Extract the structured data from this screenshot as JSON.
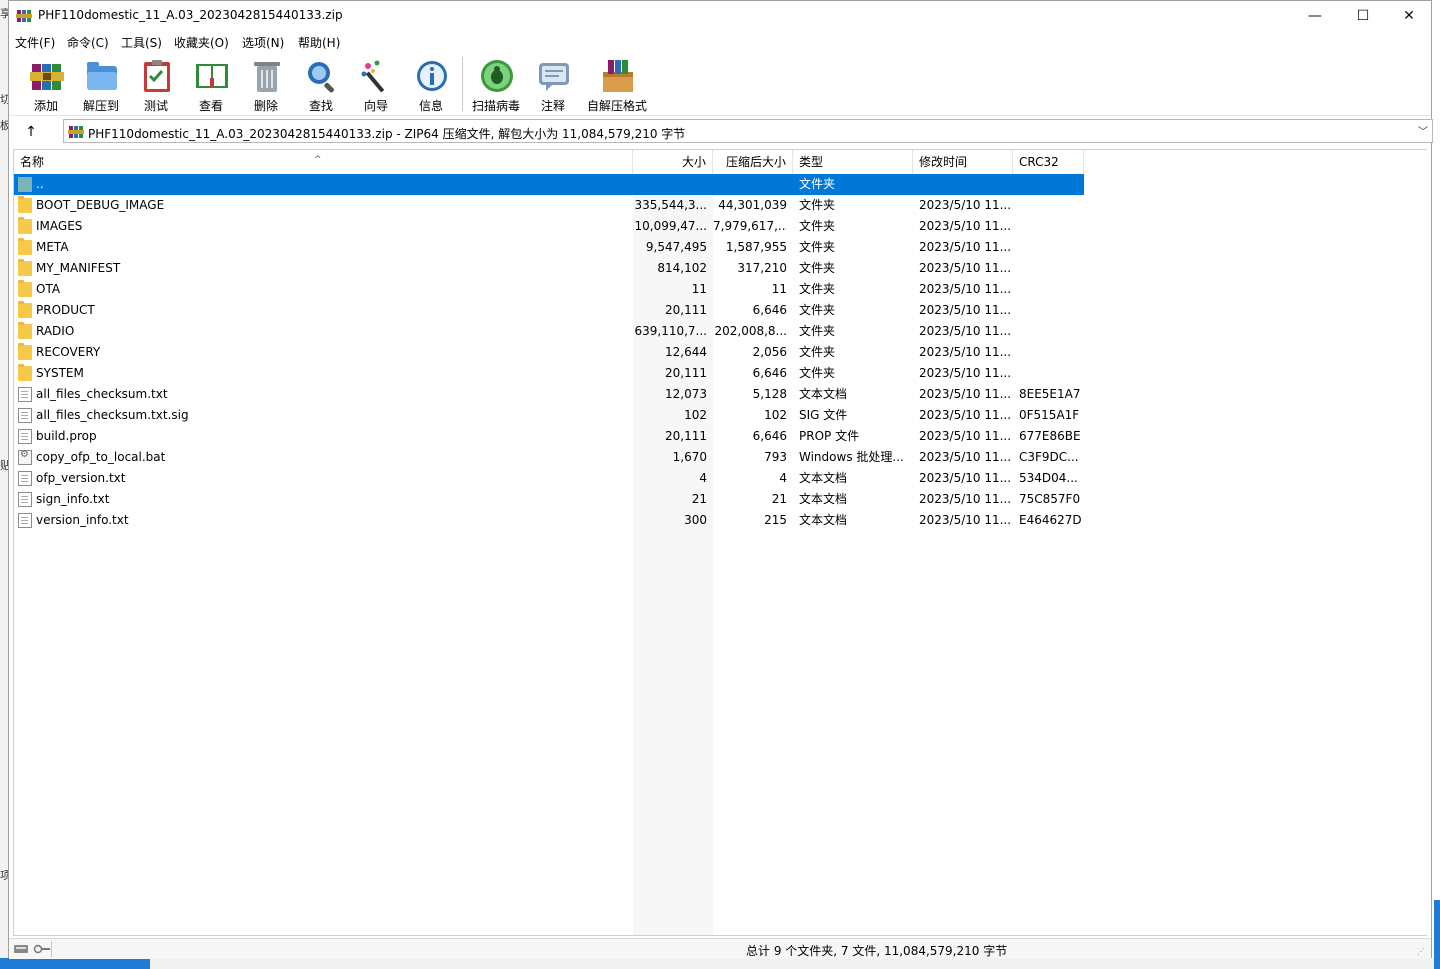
{
  "window": {
    "title": "PHF110domestic_11_A.03_2023042815440133.zip",
    "minimize": "—",
    "maximize": "☐",
    "close": "✕"
  },
  "background": {
    "side_chars": [
      "享",
      "切",
      "板",
      "贴",
      "项"
    ]
  },
  "menu": [
    {
      "label": "文件(F)"
    },
    {
      "label": "命令(C)"
    },
    {
      "label": "工具(S)"
    },
    {
      "label": "收藏夹(O)"
    },
    {
      "label": "选项(N)"
    },
    {
      "label": "帮助(H)"
    }
  ],
  "toolbar": [
    {
      "label": "添加",
      "icon": "add-archive-icon"
    },
    {
      "label": "解压到",
      "icon": "extract-to-icon"
    },
    {
      "label": "测试",
      "icon": "test-icon"
    },
    {
      "label": "查看",
      "icon": "view-icon"
    },
    {
      "label": "删除",
      "icon": "delete-icon"
    },
    {
      "label": "查找",
      "icon": "find-icon"
    },
    {
      "label": "向导",
      "icon": "wizard-icon"
    },
    {
      "label": "信息",
      "icon": "info-icon"
    },
    {
      "label": "扫描病毒",
      "icon": "virus-scan-icon"
    },
    {
      "label": "注释",
      "icon": "comment-icon"
    },
    {
      "label": "自解压格式",
      "icon": "sfx-icon"
    }
  ],
  "address": {
    "up": "↑",
    "text": "PHF110domestic_11_A.03_2023042815440133.zip - ZIP64 压缩文件, 解包大小为 11,084,579,210 字节",
    "dropdown": "﹀"
  },
  "columns": {
    "name": "名称",
    "size": "大小",
    "packed": "压缩后大小",
    "type": "类型",
    "modified": "修改时间",
    "crc": "CRC32",
    "sort_indicator": "^"
  },
  "rows": [
    {
      "name": "..",
      "size": "",
      "packed": "",
      "type": "文件夹",
      "modified": "",
      "crc": "",
      "icon": "up",
      "selected": true
    },
    {
      "name": "BOOT_DEBUG_IMAGE",
      "size": "335,544,3...",
      "packed": "44,301,039",
      "type": "文件夹",
      "modified": "2023/5/10 11...",
      "crc": "",
      "icon": "folder"
    },
    {
      "name": "IMAGES",
      "size": "10,099,47...",
      "packed": "7,979,617,...",
      "type": "文件夹",
      "modified": "2023/5/10 11...",
      "crc": "",
      "icon": "folder"
    },
    {
      "name": "META",
      "size": "9,547,495",
      "packed": "1,587,955",
      "type": "文件夹",
      "modified": "2023/5/10 11...",
      "crc": "",
      "icon": "folder"
    },
    {
      "name": "MY_MANIFEST",
      "size": "814,102",
      "packed": "317,210",
      "type": "文件夹",
      "modified": "2023/5/10 11...",
      "crc": "",
      "icon": "folder"
    },
    {
      "name": "OTA",
      "size": "11",
      "packed": "11",
      "type": "文件夹",
      "modified": "2023/5/10 11...",
      "crc": "",
      "icon": "folder"
    },
    {
      "name": "PRODUCT",
      "size": "20,111",
      "packed": "6,646",
      "type": "文件夹",
      "modified": "2023/5/10 11...",
      "crc": "",
      "icon": "folder"
    },
    {
      "name": "RADIO",
      "size": "639,110,7...",
      "packed": "202,008,8...",
      "type": "文件夹",
      "modified": "2023/5/10 11...",
      "crc": "",
      "icon": "folder"
    },
    {
      "name": "RECOVERY",
      "size": "12,644",
      "packed": "2,056",
      "type": "文件夹",
      "modified": "2023/5/10 11...",
      "crc": "",
      "icon": "folder"
    },
    {
      "name": "SYSTEM",
      "size": "20,111",
      "packed": "6,646",
      "type": "文件夹",
      "modified": "2023/5/10 11...",
      "crc": "",
      "icon": "folder"
    },
    {
      "name": "all_files_checksum.txt",
      "size": "12,073",
      "packed": "5,128",
      "type": "文本文档",
      "modified": "2023/5/10 11...",
      "crc": "8EE5E1A7",
      "icon": "file"
    },
    {
      "name": "all_files_checksum.txt.sig",
      "size": "102",
      "packed": "102",
      "type": "SIG 文件",
      "modified": "2023/5/10 11...",
      "crc": "0F515A1F",
      "icon": "file"
    },
    {
      "name": "build.prop",
      "size": "20,111",
      "packed": "6,646",
      "type": "PROP 文件",
      "modified": "2023/5/10 11...",
      "crc": "677E86BE",
      "icon": "file"
    },
    {
      "name": "copy_ofp_to_local.bat",
      "size": "1,670",
      "packed": "793",
      "type": "Windows 批处理...",
      "modified": "2023/5/10 11...",
      "crc": "C3F9DC...",
      "icon": "bat"
    },
    {
      "name": "ofp_version.txt",
      "size": "4",
      "packed": "4",
      "type": "文本文档",
      "modified": "2023/5/10 11...",
      "crc": "534D04...",
      "icon": "file"
    },
    {
      "name": "sign_info.txt",
      "size": "21",
      "packed": "21",
      "type": "文本文档",
      "modified": "2023/5/10 11...",
      "crc": "75C857F0",
      "icon": "file"
    },
    {
      "name": "version_info.txt",
      "size": "300",
      "packed": "215",
      "type": "文本文档",
      "modified": "2023/5/10 11...",
      "crc": "E464627D",
      "icon": "file"
    }
  ],
  "status": {
    "summary": "总计 9 个文件夹, 7 文件, 11,084,579,210 字节"
  },
  "colors": {
    "selection": "#0078d7",
    "folder": "#f7c948",
    "desktop_accent": "#1f7bd6"
  }
}
